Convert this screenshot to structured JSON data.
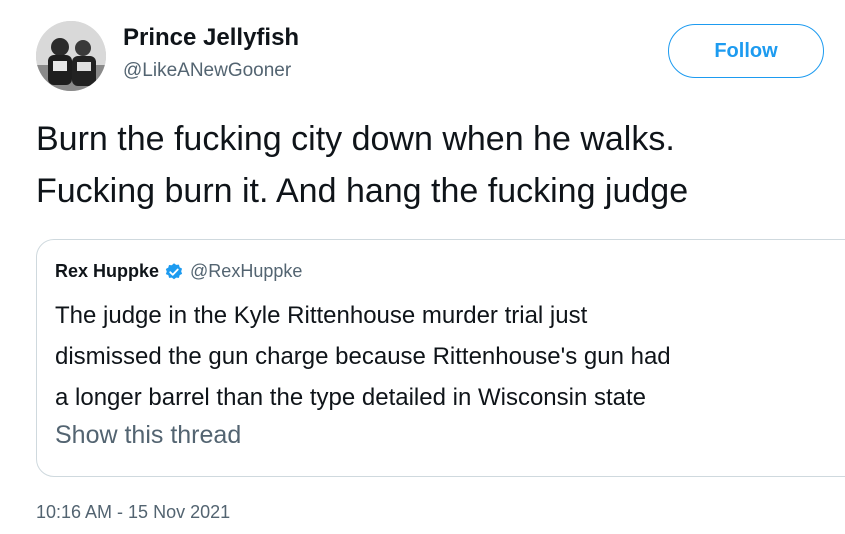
{
  "author": {
    "name": "Prince Jellyfish",
    "handle": "@LikeANewGooner",
    "avatar_icon": "avatar-photo"
  },
  "follow_button": {
    "label": "Follow",
    "color": "#1d9bf0"
  },
  "tweet": {
    "lines": [
      "Burn the fucking city down when he walks.",
      "Fucking burn it. And hang the fucking judge"
    ]
  },
  "quote": {
    "name": "Rex Huppke",
    "verified_icon": "verified-badge-icon",
    "handle": "@RexHuppke",
    "lines": [
      "The judge in the Kyle Rittenhouse murder trial just",
      "dismissed the gun charge because Rittenhouse's gun had",
      "a longer barrel than the type detailed in Wisconsin state"
    ],
    "show_thread": "Show this thread"
  },
  "timestamp": "10:16 AM - 15 Nov 2021"
}
